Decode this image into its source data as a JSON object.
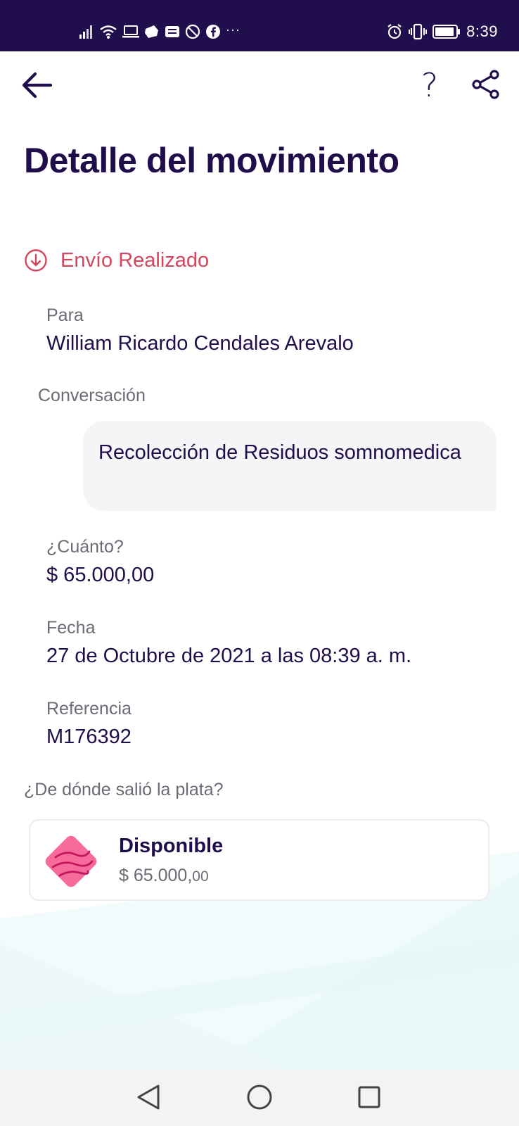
{
  "status_bar": {
    "time": "8:39",
    "more_indicator": "···",
    "left_icons": [
      "signal-icon",
      "wifi-icon",
      "laptop-icon",
      "app-icon",
      "message-icon",
      "blocked-icon",
      "facebook-icon"
    ],
    "right_icons": [
      "alarm-icon",
      "vibrate-icon",
      "battery-icon"
    ]
  },
  "header": {
    "back_icon": "arrow-left-icon",
    "help_label": "?",
    "share_icon": "share-icon"
  },
  "page": {
    "title": "Detalle del movimiento"
  },
  "movement": {
    "status_icon": "arrow-down-circle-icon",
    "status_text": "Envío Realizado",
    "status_color": "#d2465e",
    "to_label": "Para",
    "to_value": "William Ricardo Cendales Arevalo",
    "conversation_label": "Conversación",
    "conversation_message": "Recolección de Residuos somnomedica",
    "amount_label": "¿Cuánto?",
    "amount_value": "$ 65.000,00",
    "date_label": "Fecha",
    "date_value": "27 de Octubre de 2021 a las 08:39 a. m.",
    "reference_label": "Referencia",
    "reference_value": "M176392"
  },
  "source": {
    "question": "¿De dónde salió la plata?",
    "name": "Disponible",
    "amount_main": "$ 65.000,",
    "amount_cents": "00",
    "icon": "pocket-card-icon"
  },
  "nav": {
    "back": "nav-back-icon",
    "home": "nav-home-icon",
    "recents": "nav-recents-icon"
  },
  "colors": {
    "brand_dark": "#210f4d",
    "text_primary": "#200e4a",
    "text_secondary": "#6b6b76",
    "accent_pink": "#f76b9c"
  }
}
